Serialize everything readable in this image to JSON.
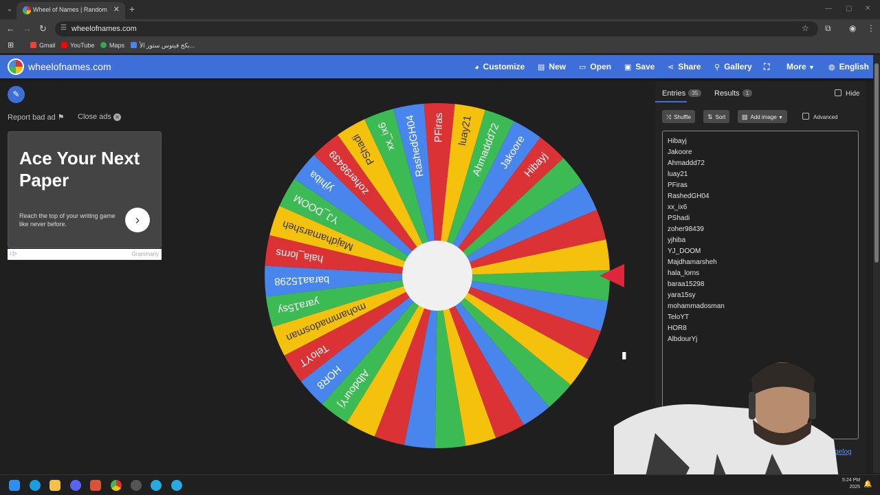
{
  "browser": {
    "tab_title": "Wheel of Names | Random name picker",
    "url": "wheelofnames.com",
    "bookmarks": [
      "Gmail",
      "YouTube",
      "Maps",
      "بكج فيتوس ستور الأ..."
    ]
  },
  "site": {
    "logo_text": "wheelofnames.com",
    "nav": {
      "customize": "Customize",
      "new": "New",
      "open": "Open",
      "save": "Save",
      "share": "Share",
      "gallery": "Gallery",
      "more": "More",
      "language": "English"
    }
  },
  "left": {
    "report_bad_ad": "Report bad ad",
    "close_ads": "Close ads",
    "ad": {
      "title": "Ace Your Next Paper",
      "subtitle": "Reach the top of your writing game like never before.",
      "brand": "Grammarly"
    }
  },
  "wheel": {
    "colors": [
      "#db3236",
      "#4885ed",
      "#3cba54",
      "#f4c20d"
    ],
    "wheel_entries": [
      "Hibayj",
      "Jakoore",
      "Ahmaddd72",
      "luay21",
      "PFiras",
      "RashedGH04",
      "xx_ix6",
      "PShadi",
      "zoher98439",
      "yjhiba",
      "YJ_DOOM",
      "Majdhamarsheh",
      "hala_lorns",
      "baraa15298",
      "yara15sy",
      "mohammadosman",
      "TeloYT",
      "HOR8",
      "AlbdourYj"
    ],
    "total_segments": 35
  },
  "panel": {
    "entries_tab": "Entries",
    "entries_count": "35",
    "results_tab": "Results",
    "results_count": "1",
    "hide_label": "Hide",
    "shuffle": "Shuffle",
    "sort": "Sort",
    "add_image": "Add image",
    "advanced": "Advanced",
    "entries": [
      "Hibayj",
      "Jakoore",
      "Ahmaddd72",
      "luay21",
      "PFiras",
      "RashedGH04",
      "xx_ix6",
      "PShadi",
      "zoher98439",
      "yjhiba",
      "YJ_DOOM",
      "Majdhamarsheh",
      "hala_lorns",
      "baraa15298",
      "yara15sy",
      "mohammadosman",
      "TeloYT",
      "HOR8",
      "AlbdourYj"
    ],
    "changelog": "angelog"
  },
  "taskbar": {
    "time": "5:24 PM",
    "date": "2025"
  }
}
